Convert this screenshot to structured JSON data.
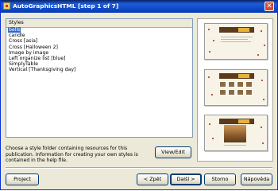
{
  "window": {
    "title": "AutoGraphicsHTML [step 1 of 7]",
    "close_glyph": "✕"
  },
  "styles": {
    "header": "Styles",
    "items": [
      "bells",
      "candle",
      "Cross [asia]",
      "Cross [Halloween 2]",
      "Image by image",
      "Left organize list [blue]",
      "SimplyTable",
      "Vertical [Thanksgiving day]"
    ],
    "selected_index": 0
  },
  "description": "Choose a style folder containing resources for this publication. Information for creating your own styles is contained in the help file.",
  "buttons": {
    "view_edit": "View/Edit",
    "project": "Project",
    "back": "< Zpět",
    "next": "Další >",
    "storno": "Storno",
    "help": "Nápověda"
  },
  "colors": {
    "titlebar": "#0a246a",
    "selection": "#316ac5",
    "dialog_bg": "#ece9d8"
  }
}
